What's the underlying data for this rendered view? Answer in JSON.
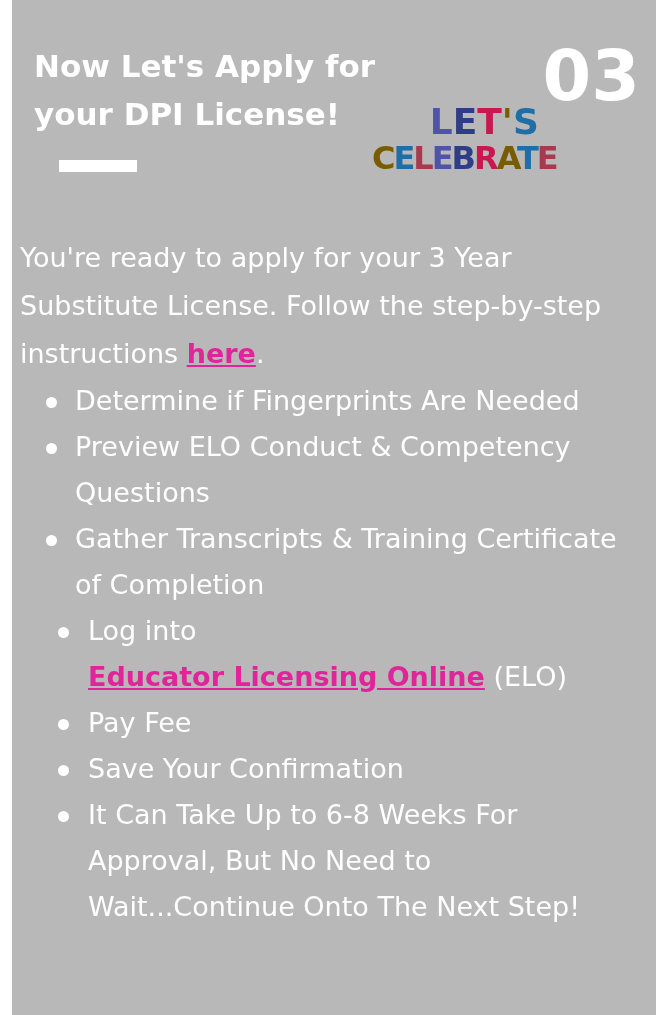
{
  "step_number": "03",
  "title": "Now Let's Apply for your DPI License!",
  "sticker": {
    "lines": [
      "LET'S",
      "CELEBRATE"
    ]
  },
  "intro": {
    "before": "You're ready to apply for your 3 Year Substitute License. Follow the step-by-step instructions ",
    "link": "here",
    "after": "."
  },
  "list_1": [
    {
      "text": "Determine if Fingerprints Are Needed"
    },
    {
      "text": "Preview ELO Conduct & Competency Questions"
    },
    {
      "text": "Gather Transcripts & Training Certificate of Completion"
    }
  ],
  "list_2": [
    {
      "text": "Log into ",
      "link": "Educator Licensing Online",
      "after": " (ELO)"
    },
    {
      "text": "Pay Fee"
    },
    {
      "text": "Save Your Confirmation"
    },
    {
      "text": "It Can Take Up to 6-8 Weeks For Approval, But No Need to Wait...Continue Onto The Next Step!"
    }
  ]
}
